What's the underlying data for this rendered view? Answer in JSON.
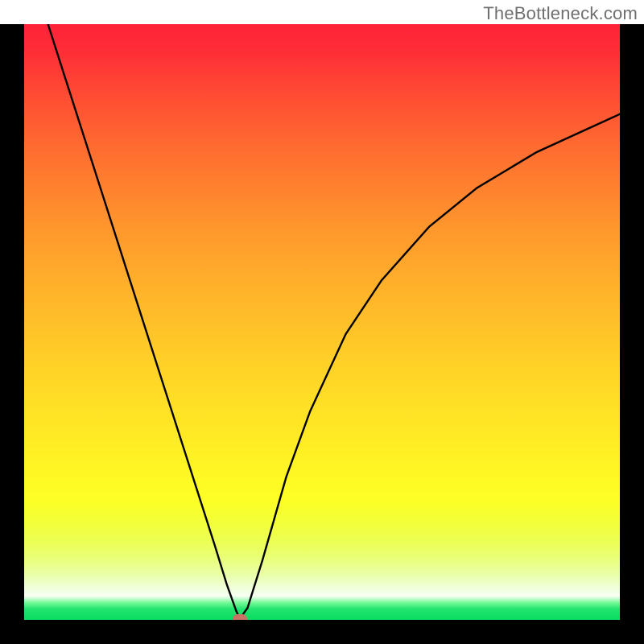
{
  "watermark": "TheBottleneck.com",
  "chart_data": {
    "type": "line",
    "title": "",
    "xlabel": "",
    "ylabel": "",
    "xlim": [
      0,
      100
    ],
    "ylim": [
      0,
      100
    ],
    "grid": false,
    "legend": false,
    "background": {
      "gradient": "vertical",
      "top_color": "#fe2238",
      "mid_color": "#ffea25",
      "bottom_color": "#09dc62"
    },
    "series": [
      {
        "name": "bottleneck-curve-left",
        "x": [
          4.0,
          8.0,
          12.0,
          16.0,
          20.0,
          24.0,
          28.0,
          32.0,
          34.0,
          35.6,
          36.2
        ],
        "y": [
          100.0,
          87.5,
          75.0,
          62.5,
          50.0,
          37.5,
          25.0,
          12.5,
          6.0,
          1.5,
          0.2
        ]
      },
      {
        "name": "bottleneck-curve-right",
        "x": [
          36.2,
          37.5,
          40.0,
          44.0,
          48.0,
          54.0,
          60.0,
          68.0,
          76.0,
          86.0,
          100.0
        ],
        "y": [
          0.2,
          2.0,
          10.0,
          24.0,
          35.0,
          48.0,
          57.0,
          66.0,
          72.5,
          78.5,
          84.9
        ]
      }
    ],
    "marker": {
      "name": "optimal-point",
      "x": 36.2,
      "y": 0.2,
      "color": "#c77366"
    },
    "frame_color": "#000000",
    "curve_color": "#000000"
  }
}
